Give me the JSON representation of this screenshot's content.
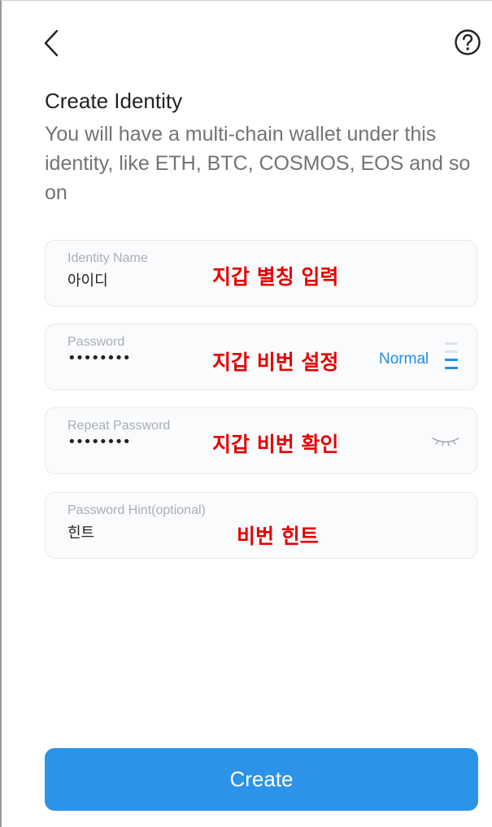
{
  "header": {
    "back_icon": "chevron-left-icon",
    "help_icon": "question-circle-icon"
  },
  "page": {
    "title": "Create Identity",
    "subtitle": "You will have a multi-chain wallet under this identity, like ETH, BTC, COSMOS, EOS and so on"
  },
  "form": {
    "identity_name": {
      "label": "Identity Name",
      "value": "아이디",
      "annotation": "지갑 별칭 입력"
    },
    "password": {
      "label": "Password",
      "value": "••••••••",
      "annotation": "지갑 비번 설정",
      "strength_label": "Normal",
      "strength_level": 0.5
    },
    "repeat_password": {
      "label": "Repeat Password",
      "value": "••••••••",
      "annotation": "지갑 비번 확인",
      "visibility_icon": "eye-closed-icon"
    },
    "password_hint": {
      "label": "Password Hint(optional)",
      "value": "힌트",
      "annotation": "비번 힌트"
    }
  },
  "actions": {
    "create_label": "Create"
  },
  "colors": {
    "accent": "#2b93e8",
    "strength_text": "#1f8fe5",
    "annotation": "#e60000",
    "field_background": "#fafbfc",
    "field_border": "#e6e8eb",
    "label": "#a9adb3",
    "subtitle": "#737373"
  }
}
